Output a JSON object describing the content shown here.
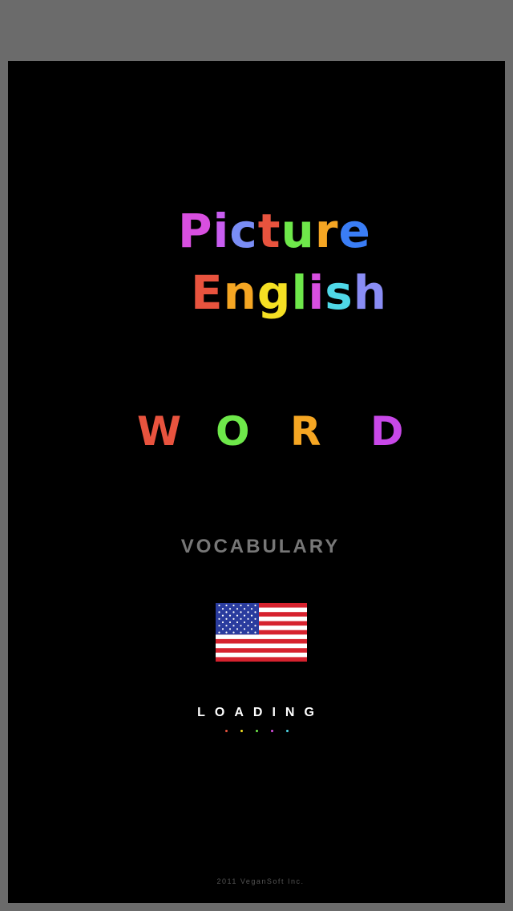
{
  "title": {
    "line1": [
      {
        "ch": "P",
        "color": "#d84fe0"
      },
      {
        "ch": "i",
        "color": "#c85df0"
      },
      {
        "ch": "c",
        "color": "#7a8df5"
      },
      {
        "ch": "t",
        "color": "#e8533e"
      },
      {
        "ch": "u",
        "color": "#6ee84a"
      },
      {
        "ch": "r",
        "color": "#f5a623"
      },
      {
        "ch": "e",
        "color": "#3a7df5"
      }
    ],
    "line2": [
      {
        "ch": "E",
        "color": "#e8533e"
      },
      {
        "ch": "n",
        "color": "#f5a623"
      },
      {
        "ch": "g",
        "color": "#f5e023"
      },
      {
        "ch": "l",
        "color": "#6ee84a"
      },
      {
        "ch": "i",
        "color": "#d84fe0"
      },
      {
        "ch": "s",
        "color": "#4fd8e8"
      },
      {
        "ch": "h",
        "color": "#8a8df5"
      }
    ]
  },
  "word": [
    {
      "ch": "W",
      "color": "#e8533e"
    },
    {
      "ch": "O",
      "color": "#6ee84a"
    },
    {
      "ch": "R",
      "color": "#f5a623"
    },
    {
      "ch": "D",
      "color": "#c848e8"
    }
  ],
  "subtitle": "VOCABULARY",
  "flag_icon": "us-flag-icon",
  "loading": {
    "label": "LOADING",
    "dot_colors": [
      "#e8533e",
      "#f5e023",
      "#6ee84a",
      "#d84fe0",
      "#4fd8e8"
    ]
  },
  "copyright": "2011 VeganSoft Inc."
}
